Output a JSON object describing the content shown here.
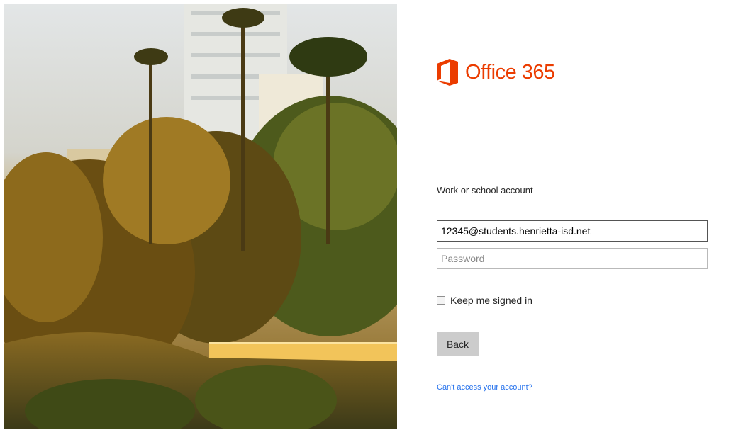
{
  "brand": {
    "logo_text": "Office 365",
    "logo_color": "#eb3c00"
  },
  "form": {
    "account_label": "Work or school account",
    "email_value": "12345@students.henrietta-isd.net",
    "password_placeholder": "Password",
    "keep_signed_in_label": "Keep me signed in",
    "keep_signed_in_checked": false,
    "back_button_label": "Back",
    "help_link_label": "Can't access your account?"
  },
  "colors": {
    "link": "#2672ec",
    "button_bg": "#cccccc"
  },
  "icons": {
    "logo": "office-logo-icon"
  }
}
